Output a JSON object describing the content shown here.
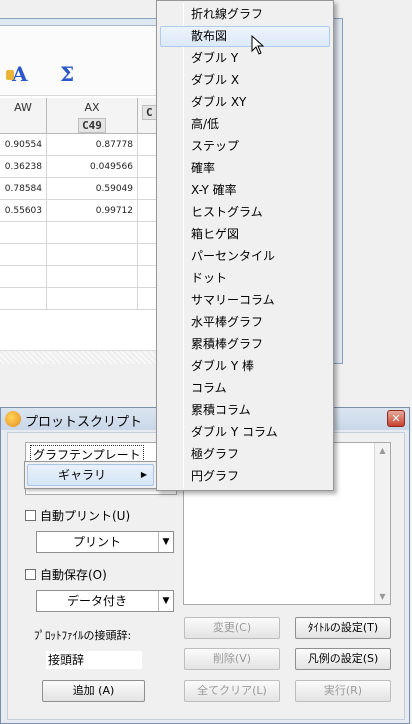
{
  "sheet": {
    "columns": [
      {
        "name": "AW",
        "code": ""
      },
      {
        "name": "AX",
        "code": "C49"
      },
      {
        "name": "",
        "code": "C"
      }
    ],
    "rows": [
      [
        "0.90554",
        "0.87778"
      ],
      [
        "0.36238",
        "0.049566"
      ],
      [
        "0.78584",
        "0.59049"
      ],
      [
        "0.55603",
        "0.99712"
      ]
    ],
    "toolbar_icons": [
      "text-a-icon",
      "sigma-icon"
    ]
  },
  "type_menu": {
    "items": [
      "折れ線グラフ",
      "散布図",
      "ダブル Y",
      "ダブル X",
      "ダブル XY",
      "高/低",
      "ステップ",
      "確率",
      "X-Y 確率",
      "ヒストグラム",
      "箱ヒゲ図",
      "パーセンタイル",
      "ドット",
      "サマリーコラム",
      "水平棒グラフ",
      "累積棒グラフ",
      "ダブル Y 棒",
      "コラム",
      "累積コラム",
      "ダブル Y コラム",
      "極グラフ",
      "円グラフ"
    ],
    "highlighted_index": 1
  },
  "dialog": {
    "title": "プロットスクリプト",
    "close_label": "✕",
    "graph_template_label": "グラフテンプレート",
    "gallery_label": "ギャラリ",
    "auto_print_label": "自動プリント(U)",
    "print_combo_value": "プリント",
    "auto_save_label": "自動保存(O)",
    "save_combo_value": "データ付き",
    "plot_prefix_caption": "ﾌﾟﾛｯﾄﾌｧｲﾙの接頭辞:",
    "prefix_input_value": "接頭辞",
    "add_button": "追加 (A)",
    "change_button": "変更(C)",
    "title_setting_button": "ﾀｲﾄﾙの設定(T)",
    "delete_button": "削除(V)",
    "legend_setting_button": "凡例の設定(S)",
    "clear_all_button": "全てクリア(L)",
    "run_button": "実行(R)"
  }
}
